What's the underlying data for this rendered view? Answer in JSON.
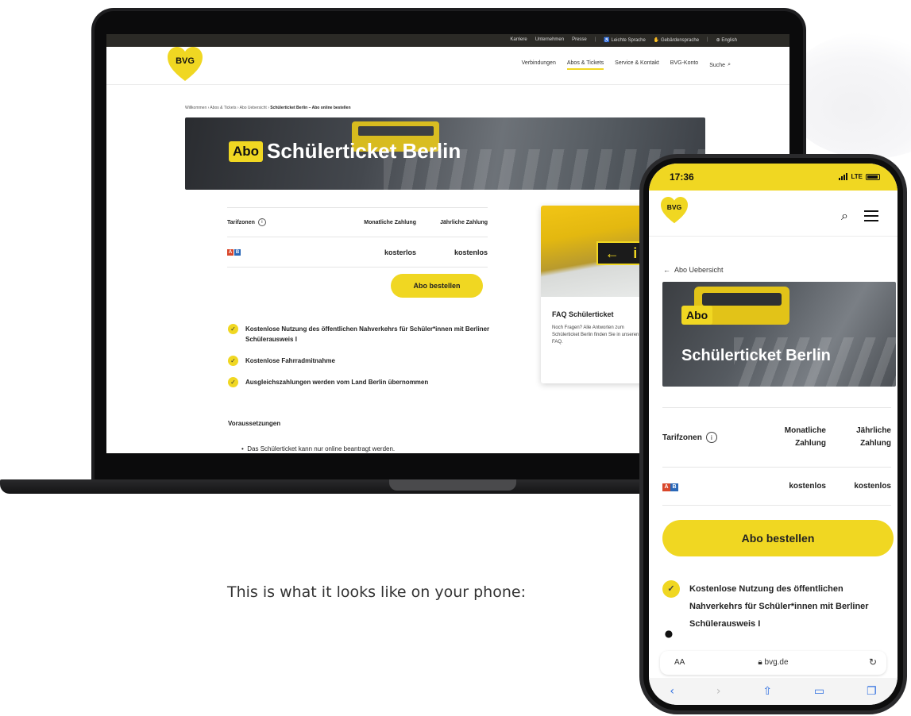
{
  "colors": {
    "brand_yellow": "#f0d722",
    "zone_a": "#d9472b",
    "zone_b": "#2a68b8",
    "ios_blue": "#2f6fe0"
  },
  "laptop": {
    "topbar": [
      "Karriere",
      "Unternehmen",
      "Presse",
      "Leichte Sprache",
      "Gebärdensprache",
      "English"
    ],
    "logo": "BVG",
    "nav": [
      "Verbindungen",
      "Abos & Tickets",
      "Service & Kontakt",
      "BVG-Konto",
      "Suche"
    ],
    "breadcrumb": {
      "path": "Willkommen › Abos & Tickets › Abo Uebersicht › ",
      "current": "Schülerticket Berlin – Abo online bestellen"
    },
    "hero": {
      "badge": "Abo",
      "title": "Schülerticket Berlin"
    },
    "table": {
      "headers": [
        "Tarifzonen",
        "Monatliche Zahlung",
        "Jährliche Zahlung"
      ],
      "zones": [
        "A",
        "B"
      ],
      "monthly": "kosterlos",
      "yearly": "kostenlos"
    },
    "order_button": "Abo bestellen",
    "features": [
      "Kostenlose Nutzung des öffentlichen Nahverkehrs für Schüler*innen mit Berliner Schülerausweis I",
      "Kostenlose Fahrradmitnahme",
      "Ausgleichszahlungen werden vom Land Berlin übernommen"
    ],
    "requirements_title": "Voraussetzungen",
    "requirements_item": "Das Schülerticket kann nur online beantragt werden.",
    "faq": {
      "title": "FAQ Schülerticket",
      "text": "Noch Fragen? Alle Antworten zum Schülerticket Berlin finden Sie in unseren FAQ."
    }
  },
  "caption": "This is what it looks like on your phone:",
  "phone": {
    "time": "17:36",
    "network": "LTE",
    "logo": "BVG",
    "back_link": "Abo Uebersicht",
    "hero": {
      "badge": "Abo",
      "title": "Schülerticket Berlin"
    },
    "table": {
      "header_zone": "Tarifzonen",
      "header_monthly_1": "Monatliche",
      "header_monthly_2": "Zahlung",
      "header_yearly_1": "Jährliche",
      "header_yearly_2": "Zahlung",
      "zones": [
        "A",
        "B"
      ],
      "monthly": "kostenlos",
      "yearly": "kostenlos"
    },
    "order_button": "Abo bestellen",
    "feature": "Kostenlose Nutzung des öffentlichen Nahverkehrs für Schüler*innen mit Berliner Schülerausweis I",
    "url_aa": "AA",
    "url": "bvg.de"
  }
}
